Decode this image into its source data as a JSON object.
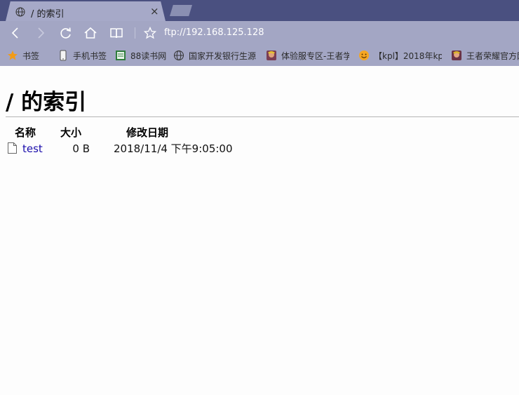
{
  "tab": {
    "title": "/ 的索引",
    "close": "×"
  },
  "toolbar": {
    "url": "ftp://192.168.125.128"
  },
  "bookmarks": [
    {
      "label": "书签",
      "icon": "star-icon"
    },
    {
      "label": "手机书签",
      "icon": "phone-icon"
    },
    {
      "label": "88读书网",
      "icon": "book-site-icon"
    },
    {
      "label": "国家开发银行生源",
      "icon": "globe-icon"
    },
    {
      "label": "体验服专区-王者学",
      "icon": "game-avatar-icon"
    },
    {
      "label": "【kpl】2018年kp",
      "icon": "smiley-site-icon"
    },
    {
      "label": "王者荣耀官方网",
      "icon": "game-avatar-icon"
    }
  ],
  "page": {
    "heading": "/ 的索引",
    "columns": {
      "name": "名称",
      "size": "大小",
      "modified": "修改日期"
    },
    "rows": [
      {
        "name": "test",
        "size": "0 B",
        "modified": "2018/11/4 下午9:05:00"
      }
    ]
  },
  "colors": {
    "tab_strip": "#4a5080",
    "toolbar": "#a3a6c4",
    "link": "#1a0dab"
  }
}
